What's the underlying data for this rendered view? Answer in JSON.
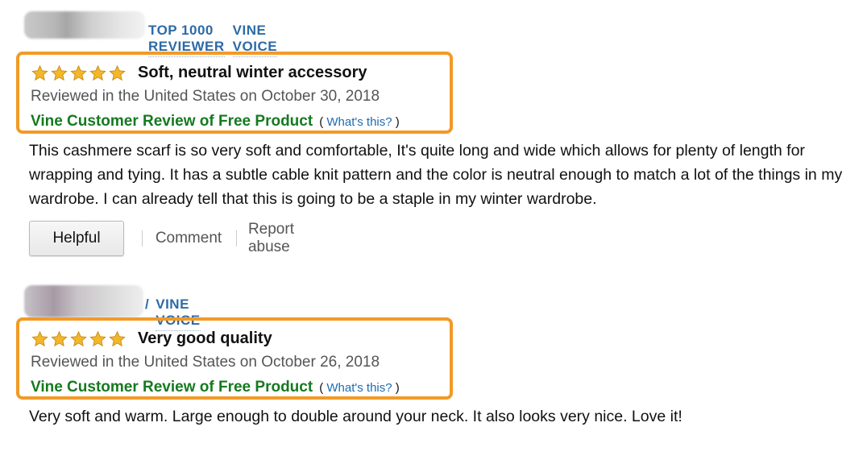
{
  "reviews": [
    {
      "badges": [
        "TOP 1000 REVIEWER",
        "VINE VOICE"
      ],
      "rating": 5,
      "title": "Soft, neutral winter accessory",
      "date": "Reviewed in the United States on October 30, 2018",
      "vine_label": "Vine Customer Review of Free Product",
      "whats_this_open": "(",
      "whats_this": "What's this?",
      "whats_this_close": ")",
      "body": "This cashmere scarf is so very soft and comfortable, It's quite long and wide which allows for plenty of length for wrapping and tying. It has a subtle cable knit pattern and the color is neutral enough to match a lot of the things in my wardrobe. I can already tell that this is going to be a staple in my winter wardrobe.",
      "actions": {
        "helpful": "Helpful",
        "comment": "Comment",
        "report": "Report abuse"
      }
    },
    {
      "badge_prefix": "/",
      "badges": [
        "VINE VOICE"
      ],
      "rating": 5,
      "title": "Very good quality",
      "date": "Reviewed in the United States on October 26, 2018",
      "vine_label": "Vine Customer Review of Free Product",
      "whats_this_open": "(",
      "whats_this": "What's this?",
      "whats_this_close": ")",
      "body": "Very soft and warm. Large enough to double around your neck. It also looks very nice. Love it!"
    }
  ],
  "colors": {
    "highlight_border": "#f29a26",
    "badge_blue": "#2d6aa6",
    "vine_green": "#157a1f",
    "star_gold": "#f3b72a",
    "link_blue": "#1f6bb0"
  },
  "icons": {
    "star": "star-icon"
  }
}
